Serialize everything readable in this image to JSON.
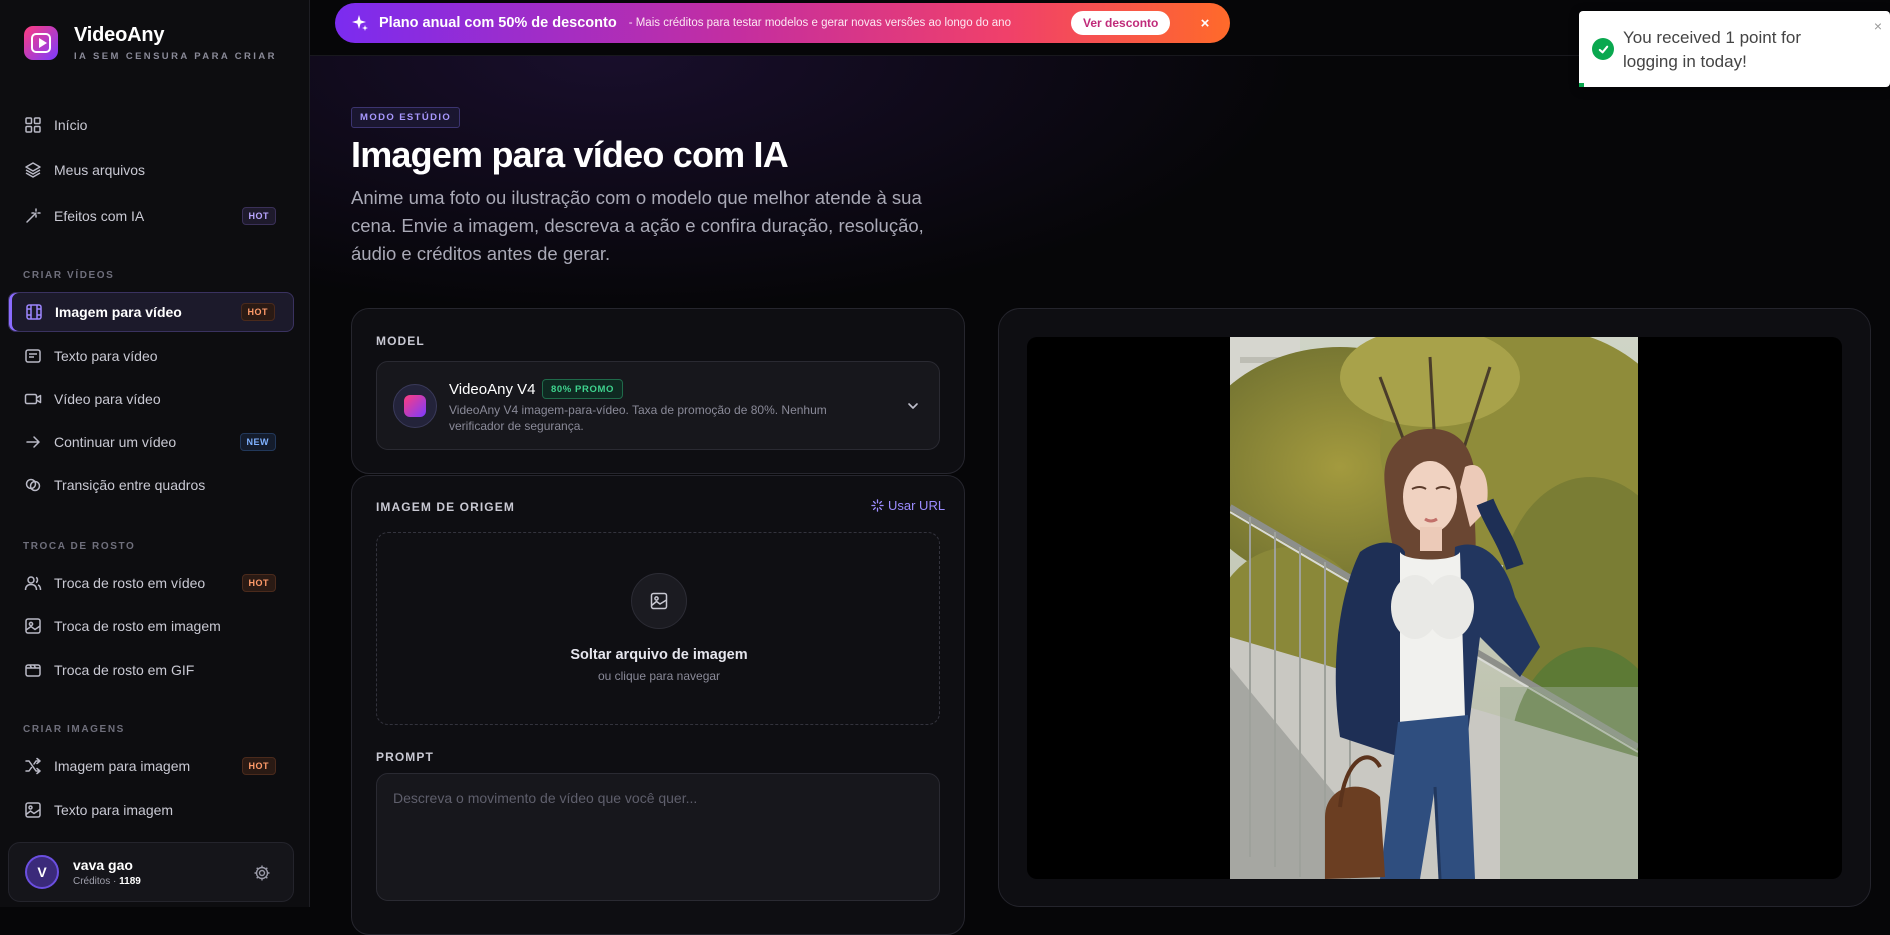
{
  "brand": {
    "name": "VideoAny",
    "tagline": "IA SEM CENSURA PARA CRIAR"
  },
  "promo": {
    "title": "Plano anual com 50% de desconto",
    "subtitle": "- Mais créditos para testar modelos e gerar novas versões ao longo do ano",
    "button": "Ver desconto",
    "close": "×"
  },
  "toast": {
    "message": "You received 1 point for logging in today!",
    "close": "×"
  },
  "sidebar": {
    "top_items": [
      {
        "label": "Início",
        "icon": "grid-icon"
      },
      {
        "label": "Meus arquivos",
        "icon": "layers-icon"
      },
      {
        "label": "Efeitos com IA",
        "icon": "magic-wand-icon",
        "badge": "HOT"
      }
    ],
    "sections": [
      {
        "title": "CRIAR VÍDEOS",
        "items": [
          {
            "label": "Imagem para vídeo",
            "icon": "film-icon",
            "badge": "HOT",
            "active": true
          },
          {
            "label": "Texto para vídeo",
            "icon": "text-box-icon"
          },
          {
            "label": "Vídeo para vídeo",
            "icon": "video-camera-icon"
          },
          {
            "label": "Continuar um vídeo",
            "icon": "arrow-right-icon",
            "badge": "NEW"
          },
          {
            "label": "Transição entre quadros",
            "icon": "transition-icon"
          }
        ]
      },
      {
        "title": "TROCA DE ROSTO",
        "items": [
          {
            "label": "Troca de rosto em vídeo",
            "icon": "users-icon",
            "badge": "HOT"
          },
          {
            "label": "Troca de rosto em imagem",
            "icon": "image-face-icon"
          },
          {
            "label": "Troca de rosto em GIF",
            "icon": "gif-film-icon"
          }
        ]
      },
      {
        "title": "CRIAR IMAGENS",
        "items": [
          {
            "label": "Imagem para imagem",
            "icon": "shuffle-icon",
            "badge": "HOT"
          },
          {
            "label": "Texto para imagem",
            "icon": "image-icon"
          }
        ]
      }
    ],
    "user": {
      "initial": "V",
      "name": "vava gao",
      "credits_label": "Créditos ·",
      "credits": "1189"
    }
  },
  "header": {
    "mode_tag": "MODO ESTÚDIO",
    "title": "Imagem para vídeo com IA",
    "description": "Anime uma foto ou ilustração com o modelo que melhor atende à sua cena. Envie a imagem, descreva a ação e confira duração, resolução, áudio e créditos antes de gerar."
  },
  "model": {
    "label": "MODEL",
    "name": "VideoAny V4",
    "promo_badge": "80% PROMO",
    "description": "VideoAny V4 imagem-para-vídeo. Taxa de promoção de 80%. Nenhum verificador de segurança."
  },
  "source_image": {
    "label": "IMAGEM DE ORIGEM",
    "use_url": "Usar URL",
    "drop_title": "Soltar arquivo de imagem",
    "drop_subtitle": "ou clique para navegar"
  },
  "prompt": {
    "label": "PROMPT",
    "placeholder": "Descreva o movimento de vídeo que você quer...",
    "value": ""
  },
  "colors": {
    "accent": "#8b6cff",
    "success": "#0aa84f",
    "hot": "#ff9b6a"
  }
}
